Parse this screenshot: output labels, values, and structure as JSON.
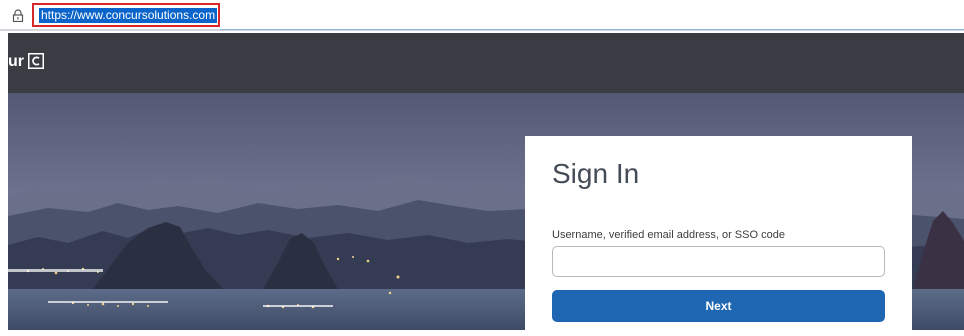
{
  "browser": {
    "url": "https://www.concursolutions.com",
    "lock_icon": "lock-icon"
  },
  "header": {
    "brand_partial": "ur",
    "logo_icon": "concur-c-logo-icon",
    "background": "#393c43"
  },
  "signin": {
    "title": "Sign In",
    "username_label": "Username, verified email address, or SSO code",
    "username_value": "",
    "next_label": "Next",
    "button_color": "#1f67b3"
  }
}
